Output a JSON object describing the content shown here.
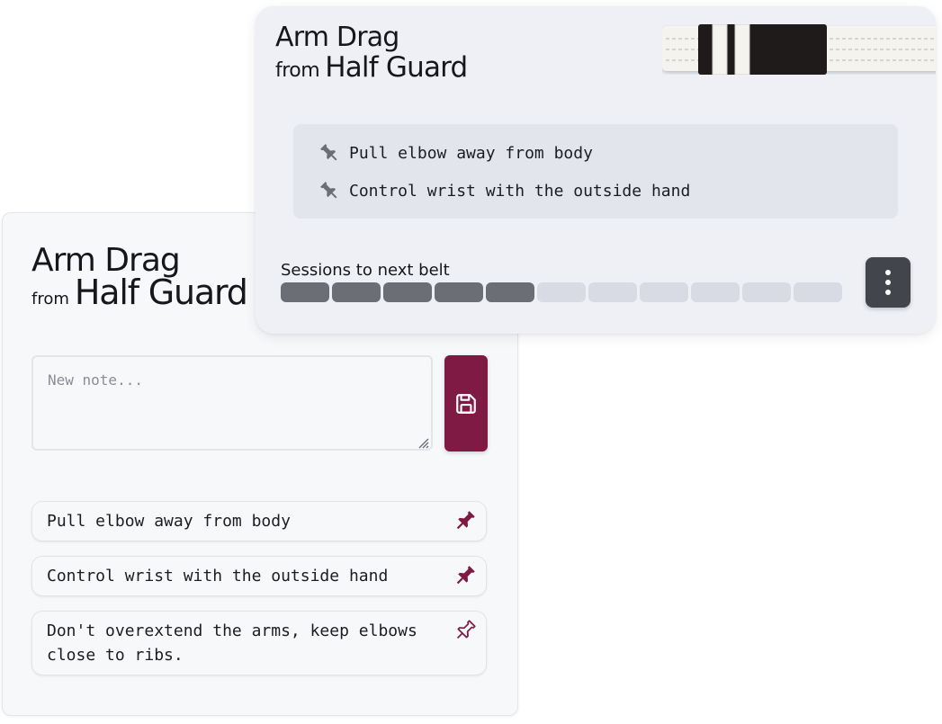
{
  "technique": {
    "name": "Arm Drag",
    "from_word": "from",
    "position": "Half Guard"
  },
  "editor": {
    "placeholder": "New note...",
    "save_icon": "floppy-disk-icon"
  },
  "notes": [
    {
      "text": "Pull elbow away from body",
      "pinned": true
    },
    {
      "text": "Control wrist with the outside hand",
      "pinned": true
    },
    {
      "text": "Don't overextend the arms, keep elbows close to ribs.",
      "pinned": false
    }
  ],
  "summary": {
    "pinned_notes": [
      "Pull elbow away from body",
      "Control wrist with the outside hand"
    ],
    "belt": {
      "color": "white",
      "stripes": 2
    },
    "progress": {
      "label": "Sessions to next belt",
      "completed": 5,
      "total": 11
    },
    "menu_icon": "vertical-dots-icon"
  },
  "colors": {
    "accent": "#7e1a43",
    "progress_done": "#6b6e75",
    "progress_todo": "#d8dbe3",
    "menu_button": "#42454c"
  }
}
